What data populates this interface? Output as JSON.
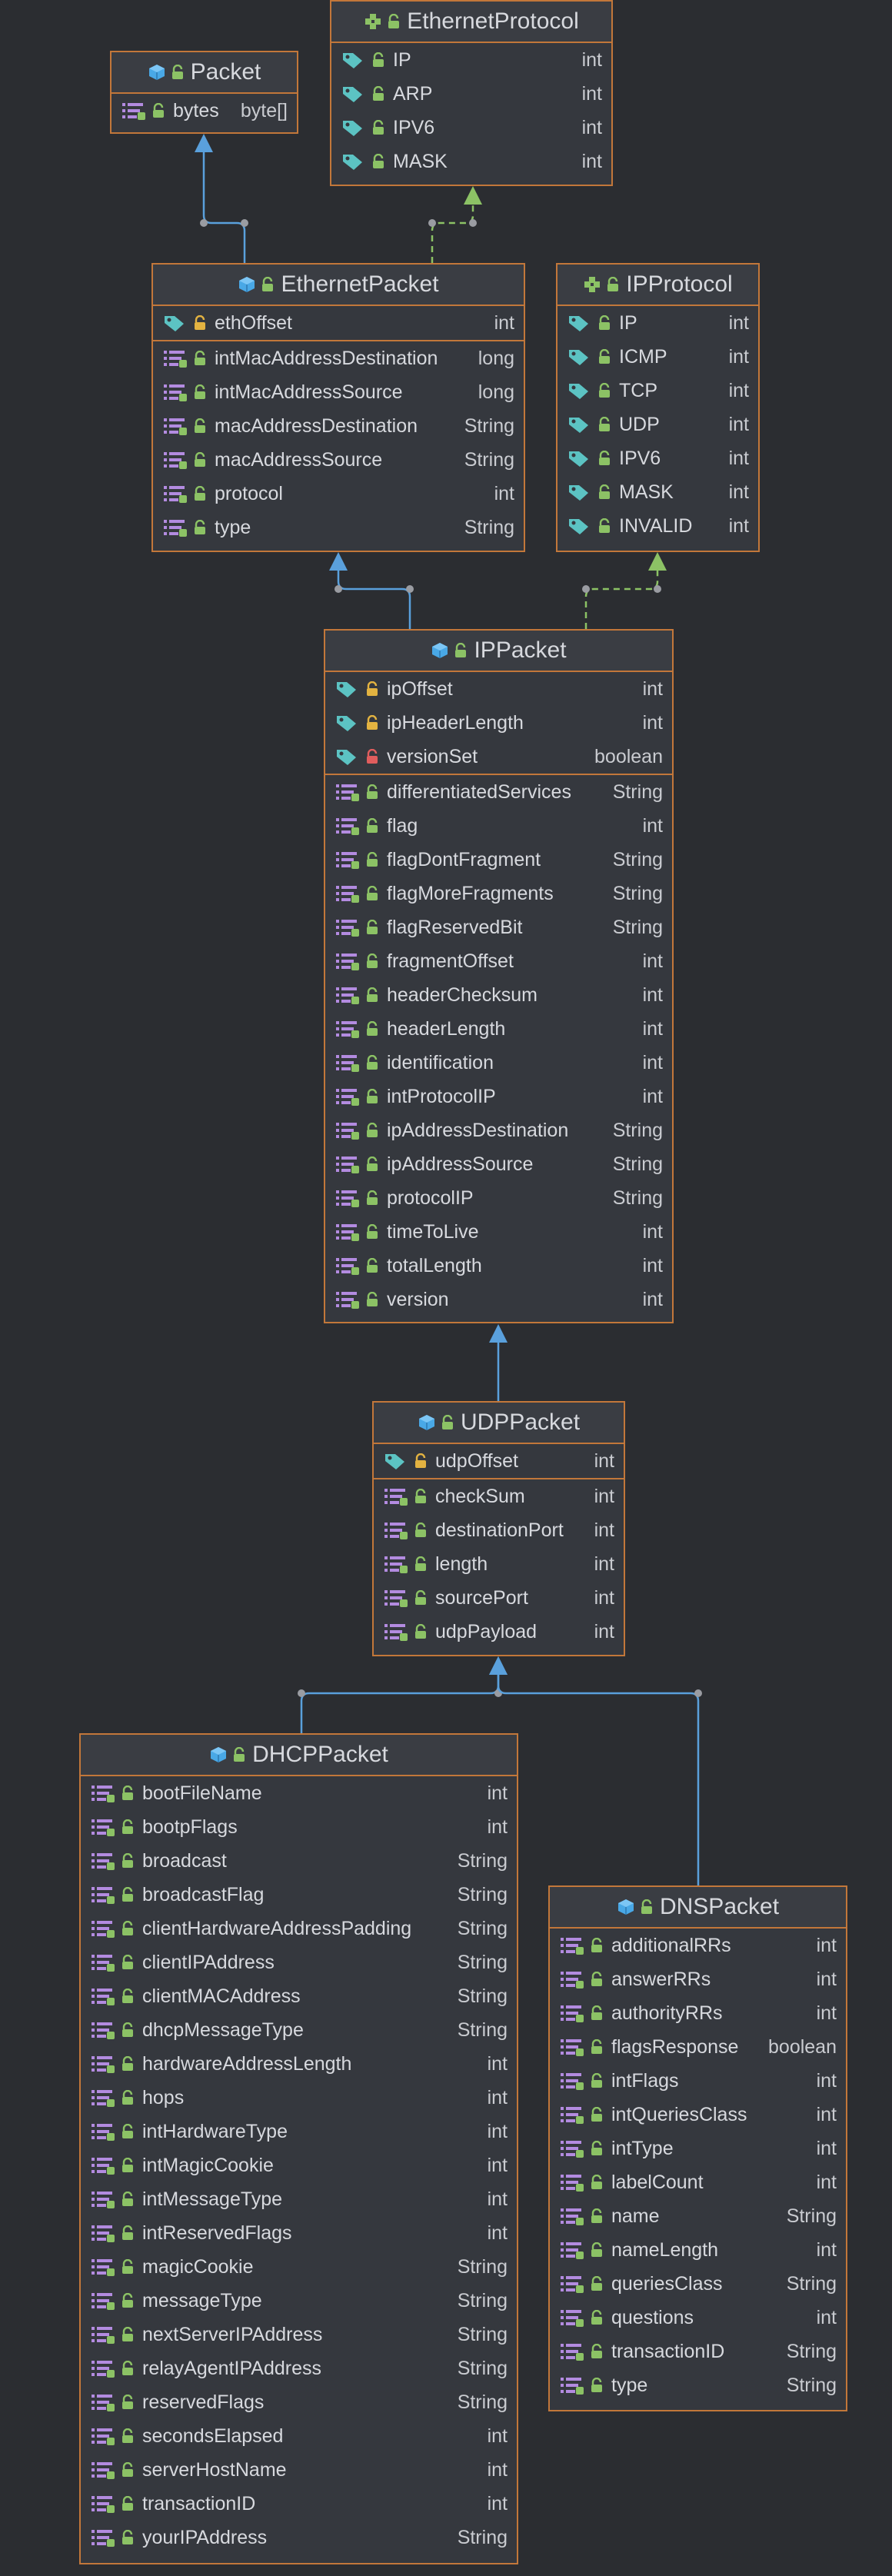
{
  "colors": {
    "background": "#2b2d31",
    "box_border": "#c2773a",
    "box_fill": "#35383e",
    "inheritance_arrow": "#5aa0dc",
    "implementation_arrow": "#8cc265",
    "text": "#d7d9de"
  },
  "icons": {
    "class": "class-cube-icon",
    "interface": "interface-puzzle-icon",
    "public": "open-lock-icon",
    "protected": "yellow-lock-icon",
    "private": "red-lock-icon",
    "field": "field-bars-icon",
    "constant": "constant-tag-icon"
  },
  "nodes": {
    "ethernet_protocol": {
      "name": "EthernetProtocol",
      "fields": [
        {
          "name": "IP",
          "type": "int"
        },
        {
          "name": "ARP",
          "type": "int"
        },
        {
          "name": "IPV6",
          "type": "int"
        },
        {
          "name": "MASK",
          "type": "int"
        }
      ]
    },
    "packet": {
      "name": "Packet",
      "fields": [
        {
          "name": "bytes",
          "type": "byte[]"
        }
      ]
    },
    "ethernet_packet": {
      "name": "EthernetPacket",
      "constants": [
        {
          "name": "ethOffset",
          "type": "int"
        }
      ],
      "fields": [
        {
          "name": "intMacAddressDestination",
          "type": "long"
        },
        {
          "name": "intMacAddressSource",
          "type": "long"
        },
        {
          "name": "macAddressDestination",
          "type": "String"
        },
        {
          "name": "macAddressSource",
          "type": "String"
        },
        {
          "name": "protocol",
          "type": "int"
        },
        {
          "name": "type",
          "type": "String"
        }
      ]
    },
    "ip_protocol": {
      "name": "IPProtocol",
      "fields": [
        {
          "name": "IP",
          "type": "int"
        },
        {
          "name": "ICMP",
          "type": "int"
        },
        {
          "name": "TCP",
          "type": "int"
        },
        {
          "name": "UDP",
          "type": "int"
        },
        {
          "name": "IPV6",
          "type": "int"
        },
        {
          "name": "MASK",
          "type": "int"
        },
        {
          "name": "INVALID",
          "type": "int"
        }
      ]
    },
    "ip_packet": {
      "name": "IPPacket",
      "constants": [
        {
          "name": "ipOffset",
          "type": "int"
        },
        {
          "name": "ipHeaderLength",
          "type": "int"
        },
        {
          "name": "versionSet",
          "type": "boolean"
        }
      ],
      "fields": [
        {
          "name": "differentiatedServices",
          "type": "String"
        },
        {
          "name": "flag",
          "type": "int"
        },
        {
          "name": "flagDontFragment",
          "type": "String"
        },
        {
          "name": "flagMoreFragments",
          "type": "String"
        },
        {
          "name": "flagReservedBit",
          "type": "String"
        },
        {
          "name": "fragmentOffset",
          "type": "int"
        },
        {
          "name": "headerChecksum",
          "type": "int"
        },
        {
          "name": "headerLength",
          "type": "int"
        },
        {
          "name": "identification",
          "type": "int"
        },
        {
          "name": "intProtocolIP",
          "type": "int"
        },
        {
          "name": "ipAddressDestination",
          "type": "String"
        },
        {
          "name": "ipAddressSource",
          "type": "String"
        },
        {
          "name": "protocolIP",
          "type": "String"
        },
        {
          "name": "timeToLive",
          "type": "int"
        },
        {
          "name": "totalLength",
          "type": "int"
        },
        {
          "name": "version",
          "type": "int"
        }
      ]
    },
    "udp_packet": {
      "name": "UDPPacket",
      "constants": [
        {
          "name": "udpOffset",
          "type": "int"
        }
      ],
      "fields": [
        {
          "name": "checkSum",
          "type": "int"
        },
        {
          "name": "destinationPort",
          "type": "int"
        },
        {
          "name": "length",
          "type": "int"
        },
        {
          "name": "sourcePort",
          "type": "int"
        },
        {
          "name": "udpPayload",
          "type": "int"
        }
      ]
    },
    "dhcp_packet": {
      "name": "DHCPPacket",
      "fields": [
        {
          "name": "bootFileName",
          "type": "int"
        },
        {
          "name": "bootpFlags",
          "type": "int"
        },
        {
          "name": "broadcast",
          "type": "String"
        },
        {
          "name": "broadcastFlag",
          "type": "String"
        },
        {
          "name": "clientHardwareAddressPadding",
          "type": "String"
        },
        {
          "name": "clientIPAddress",
          "type": "String"
        },
        {
          "name": "clientMACAddress",
          "type": "String"
        },
        {
          "name": "dhcpMessageType",
          "type": "String"
        },
        {
          "name": "hardwareAddressLength",
          "type": "int"
        },
        {
          "name": "hops",
          "type": "int"
        },
        {
          "name": "intHardwareType",
          "type": "int"
        },
        {
          "name": "intMagicCookie",
          "type": "int"
        },
        {
          "name": "intMessageType",
          "type": "int"
        },
        {
          "name": "intReservedFlags",
          "type": "int"
        },
        {
          "name": "magicCookie",
          "type": "String"
        },
        {
          "name": "messageType",
          "type": "String"
        },
        {
          "name": "nextServerIPAddress",
          "type": "String"
        },
        {
          "name": "relayAgentIPAddress",
          "type": "String"
        },
        {
          "name": "reservedFlags",
          "type": "String"
        },
        {
          "name": "secondsElapsed",
          "type": "int"
        },
        {
          "name": "serverHostName",
          "type": "int"
        },
        {
          "name": "transactionID",
          "type": "int"
        },
        {
          "name": "yourIPAddress",
          "type": "String"
        }
      ]
    },
    "dns_packet": {
      "name": "DNSPacket",
      "fields": [
        {
          "name": "additionalRRs",
          "type": "int"
        },
        {
          "name": "answerRRs",
          "type": "int"
        },
        {
          "name": "authorityRRs",
          "type": "int"
        },
        {
          "name": "flagsResponse",
          "type": "boolean"
        },
        {
          "name": "intFlags",
          "type": "int"
        },
        {
          "name": "intQueriesClass",
          "type": "int"
        },
        {
          "name": "intType",
          "type": "int"
        },
        {
          "name": "labelCount",
          "type": "int"
        },
        {
          "name": "name",
          "type": "String"
        },
        {
          "name": "nameLength",
          "type": "int"
        },
        {
          "name": "queriesClass",
          "type": "String"
        },
        {
          "name": "questions",
          "type": "int"
        },
        {
          "name": "transactionID",
          "type": "String"
        },
        {
          "name": "type",
          "type": "String"
        }
      ]
    }
  },
  "edges": [
    {
      "from": "ethernet_packet",
      "to": "packet",
      "kind": "extends"
    },
    {
      "from": "ethernet_packet",
      "to": "ethernet_protocol",
      "kind": "implements"
    },
    {
      "from": "ip_packet",
      "to": "ethernet_packet",
      "kind": "extends"
    },
    {
      "from": "ip_packet",
      "to": "ip_protocol",
      "kind": "implements"
    },
    {
      "from": "udp_packet",
      "to": "ip_packet",
      "kind": "extends"
    },
    {
      "from": "dhcp_packet",
      "to": "udp_packet",
      "kind": "extends"
    },
    {
      "from": "dns_packet",
      "to": "udp_packet",
      "kind": "extends"
    }
  ]
}
